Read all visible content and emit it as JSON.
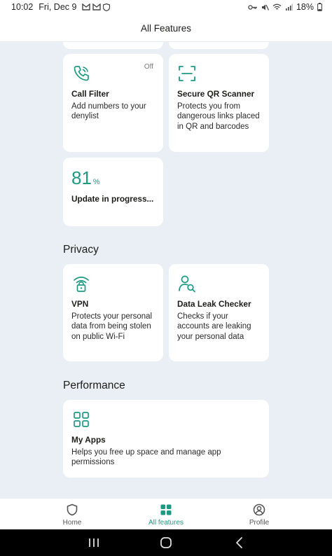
{
  "status": {
    "time": "10:02",
    "date": "Fri, Dec 9",
    "battery": "18%"
  },
  "header": {
    "title": "All Features"
  },
  "features": {
    "call_filter": {
      "name": "Call Filter",
      "desc": "Add numbers to your denylist",
      "badge": "Off",
      "icon": "phone-icon"
    },
    "qr_scanner": {
      "name": "Secure QR Scanner",
      "desc": "Protects you from dangerous links placed in QR and barcodes",
      "icon": "qr-scan-icon"
    },
    "update": {
      "value": "81",
      "unit": "%",
      "label": "Update in progress..."
    }
  },
  "privacy": {
    "title": "Privacy",
    "vpn": {
      "name": "VPN",
      "desc": "Protects your personal data from being stolen on public Wi-Fi",
      "icon": "wifi-lock-icon"
    },
    "data_leak": {
      "name": "Data Leak Checker",
      "desc": "Checks if your accounts are leaking your personal data",
      "icon": "user-search-icon"
    }
  },
  "performance": {
    "title": "Performance",
    "my_apps": {
      "name": "My Apps",
      "desc": "Helps you free up space and manage app permissions",
      "icon": "apps-grid-icon"
    }
  },
  "nav": {
    "home": "Home",
    "all_features": "All features",
    "profile": "Profile"
  },
  "colors": {
    "accent": "#1e9a84",
    "background": "#e9eff4"
  }
}
